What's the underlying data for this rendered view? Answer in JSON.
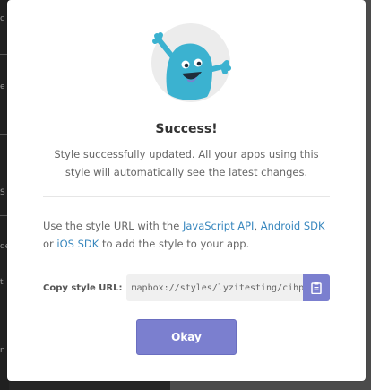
{
  "background": {
    "fragments": [
      "c",
      "e",
      "S",
      "de",
      "t",
      "n"
    ]
  },
  "modal": {
    "title": "Success!",
    "description": "Style successfully updated. All your apps using this style will automatically see the latest changes.",
    "info": {
      "prefix": "Use the style URL with the ",
      "link_js": "JavaScript API",
      "sep1": ", ",
      "link_android": "Android SDK",
      "sep2": " or ",
      "link_ios": "iOS SDK",
      "suffix": " to add the style to your app."
    },
    "url": {
      "label": "Copy style URL:",
      "value": "mapbox://styles/lyzitesting/cihp..."
    },
    "okay_label": "Okay"
  },
  "colors": {
    "accent": "#7b7fcf",
    "link": "#3887be",
    "mascot": "#3bb2d0"
  },
  "icons": {
    "mascot": "success-mascot-icon",
    "copy": "clipboard-icon"
  }
}
